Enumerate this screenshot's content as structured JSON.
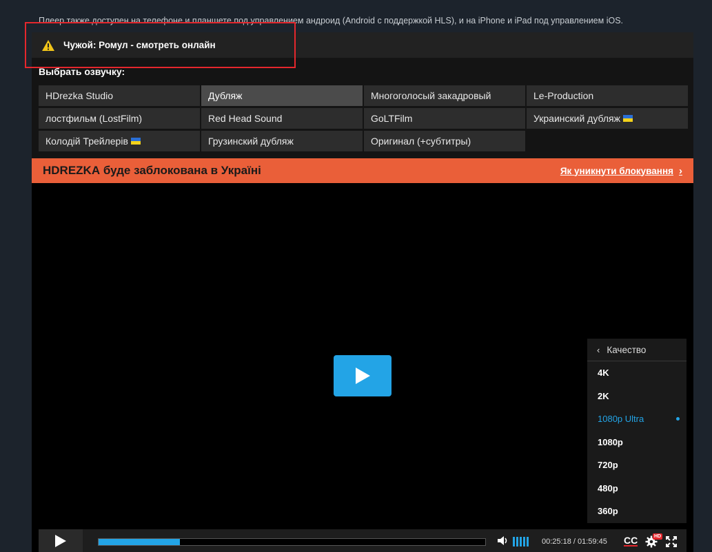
{
  "top_note": "Плеер также доступен на телефоне и планшете под управлением андроид (Android с поддержкой HLS), и на iPhone и iPad под управлением iOS.",
  "title": "Чужой: Ромул - смотреть онлайн",
  "voice_label": "Выбрать озвучку:",
  "voices": [
    {
      "label": "HDrezka Studio",
      "active": false,
      "flag": false
    },
    {
      "label": "Дубляж",
      "active": true,
      "flag": false
    },
    {
      "label": "Многоголосый закадровый",
      "active": false,
      "flag": false
    },
    {
      "label": "Le-Production",
      "active": false,
      "flag": false
    },
    {
      "label": "лостфильм (LostFilm)",
      "active": false,
      "flag": false
    },
    {
      "label": "Red Head Sound",
      "active": false,
      "flag": false
    },
    {
      "label": "GoLTFilm",
      "active": false,
      "flag": false
    },
    {
      "label": "Украинский дубляж",
      "active": false,
      "flag": true
    },
    {
      "label": "Колодій Трейлерів",
      "active": false,
      "flag": true
    },
    {
      "label": "Грузинский дубляж",
      "active": false,
      "flag": false
    },
    {
      "label": "Оригинал (+субтитры)",
      "active": false,
      "flag": false
    }
  ],
  "banner": {
    "brand": "HDREZKA",
    "text": " буде заблокована в Україні",
    "link": "Як уникнути блокування"
  },
  "quality_menu": {
    "header": "Качество",
    "items": [
      "4K",
      "2K",
      "1080p Ultra",
      "1080p",
      "720p",
      "480p",
      "360p"
    ],
    "selected": "1080p Ultra"
  },
  "controls": {
    "progress": 0.21,
    "time_current": "00:25:18",
    "time_sep": " / ",
    "time_total": "01:59:45",
    "cc_label": "CC",
    "hd_label": "HD"
  },
  "colors": {
    "accent": "#23a4e6",
    "banner": "#ea5f39",
    "highlight_box": "#e5272d"
  }
}
